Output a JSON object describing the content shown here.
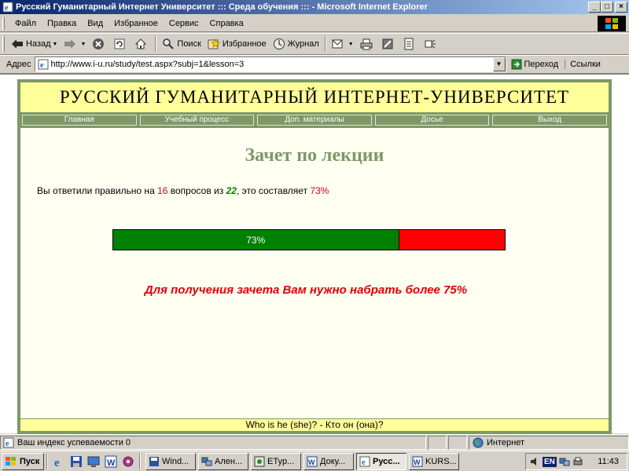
{
  "window": {
    "title": "Русский Гуманитарный Интернет Университет ::: Среда обучения ::: - Microsoft Internet Explorer",
    "min_label": "_",
    "max_label": "□",
    "close_label": "×"
  },
  "menu": {
    "items": [
      "Файл",
      "Правка",
      "Вид",
      "Избранное",
      "Сервис",
      "Справка"
    ]
  },
  "toolbar": {
    "back_label": "Назад",
    "search_label": "Поиск",
    "favorites_label": "Избранное",
    "history_label": "Журнал"
  },
  "address": {
    "label": "Адрес",
    "url": "http://www.i-u.ru/study/test.aspx?subj=1&lesson=3",
    "go_label": "Переход",
    "links_label": "Ссылки"
  },
  "site": {
    "header": "РУССКИЙ ГУМАНИТАРНЫЙ ИНТЕРНЕТ-УНИВЕРСИТЕТ",
    "nav": [
      "Главная",
      "Учебный процесс",
      "Доп. материалы",
      "Досье",
      "Выход"
    ],
    "title": "Зачет по лекции",
    "result": {
      "prefix": "Вы ответили правильно на ",
      "correct": "16",
      "middle": " вопросов из ",
      "total": "22",
      "suffix": ", это составляет ",
      "percent": "73%"
    },
    "progress": {
      "fraction": 0.73,
      "label": "73%"
    },
    "notice": "Для получения зачета Вам нужно набрать более 75%",
    "footer": "Who is he (she)? - Кто он (она)?"
  },
  "status": {
    "text": "Ваш индекс успеваемости 0",
    "zone": "Интернет"
  },
  "taskbar": {
    "start_label": "Пуск",
    "tasks": [
      "Wind...",
      "Ален...",
      "ETyp...",
      "Доку...",
      "Русс...",
      "KURS..."
    ],
    "active_index": 4,
    "lang": "EN",
    "clock": "11:43"
  },
  "colors": {
    "frame_green": "#7e9867",
    "header_yellow": "#ffff99",
    "progress_fill": "#008000",
    "progress_rest": "#ff0000",
    "alert_red": "#e00000"
  }
}
